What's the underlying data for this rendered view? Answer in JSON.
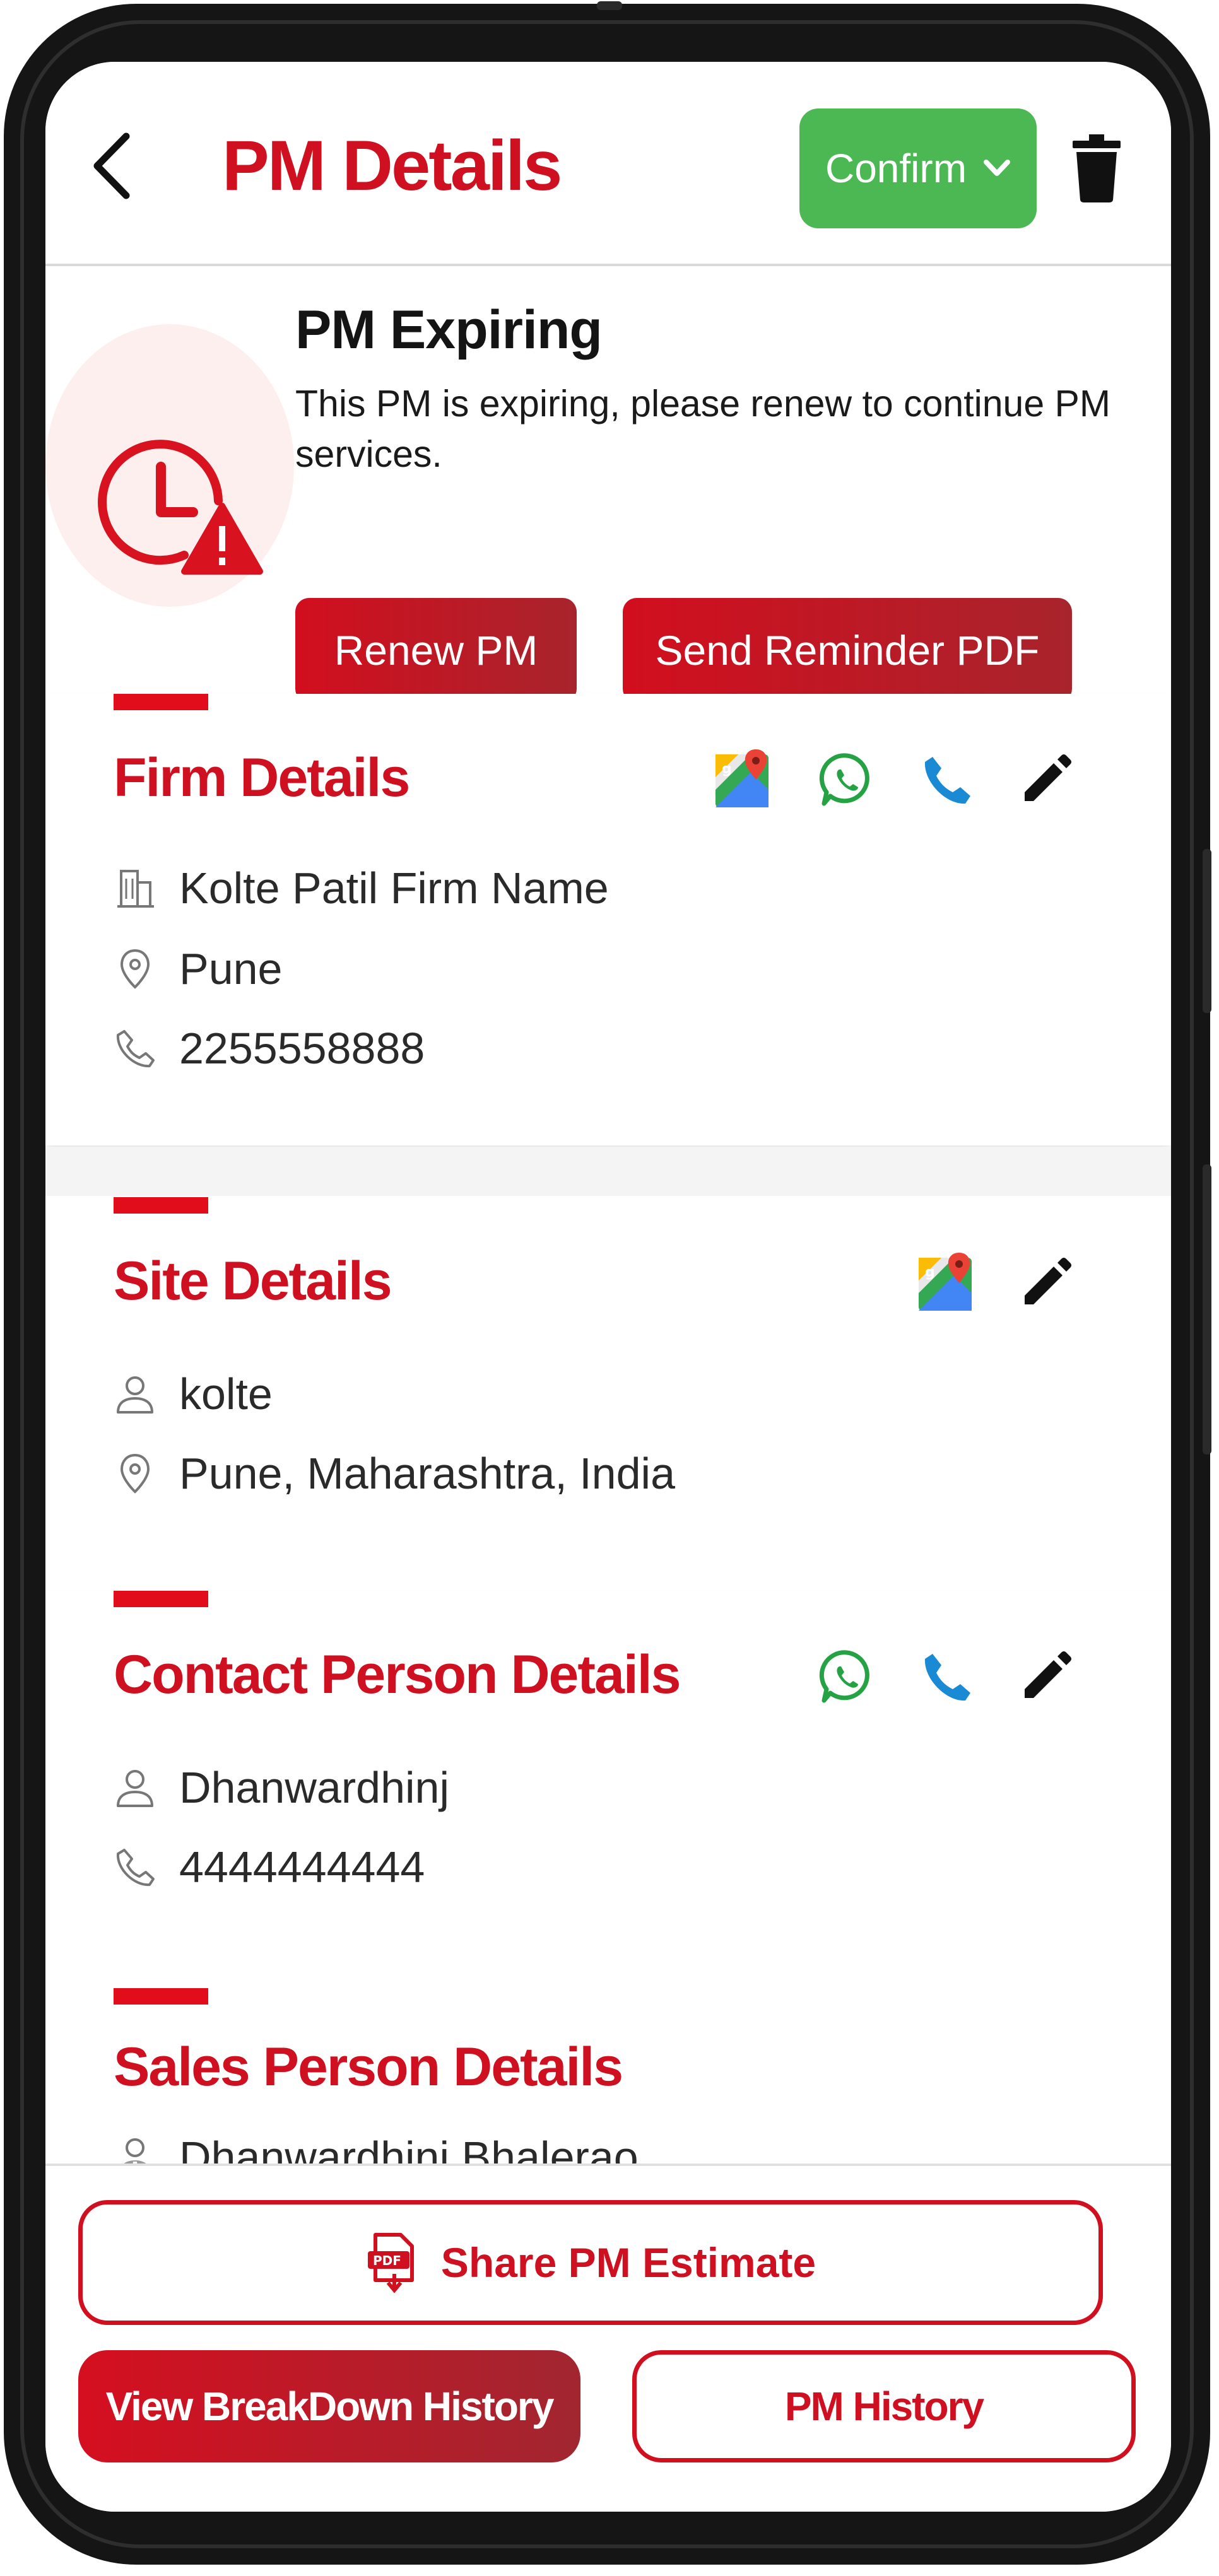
{
  "header": {
    "title": "PM Details",
    "confirm_label": "Confirm"
  },
  "expiring": {
    "title": "PM Expiring",
    "message": "This PM is expiring, please renew to continue PM services.",
    "renew_label": "Renew PM",
    "reminder_label": "Send Reminder PDF"
  },
  "firm": {
    "title": "Firm Details",
    "name": "Kolte Patil Firm Name",
    "city": "Pune",
    "phone": "2255558888"
  },
  "site": {
    "title": "Site Details",
    "person": "kolte",
    "location": "Pune, Maharashtra, India"
  },
  "contact": {
    "title": "Contact Person Details",
    "name": "Dhanwardhinj",
    "phone": "4444444444"
  },
  "sales": {
    "title": "Sales Person Details",
    "name": "Dhanwardhini Bhalerao"
  },
  "bottom": {
    "share_label": "Share PM Estimate",
    "pdf_badge": "PDF",
    "breakdown_label": "View BreakDown History",
    "history_label": "PM History"
  },
  "colors": {
    "brand_red": "#cf1020",
    "confirm_green": "#4cb853",
    "whatsapp_green": "#25a244",
    "call_blue": "#1a8ad4"
  }
}
